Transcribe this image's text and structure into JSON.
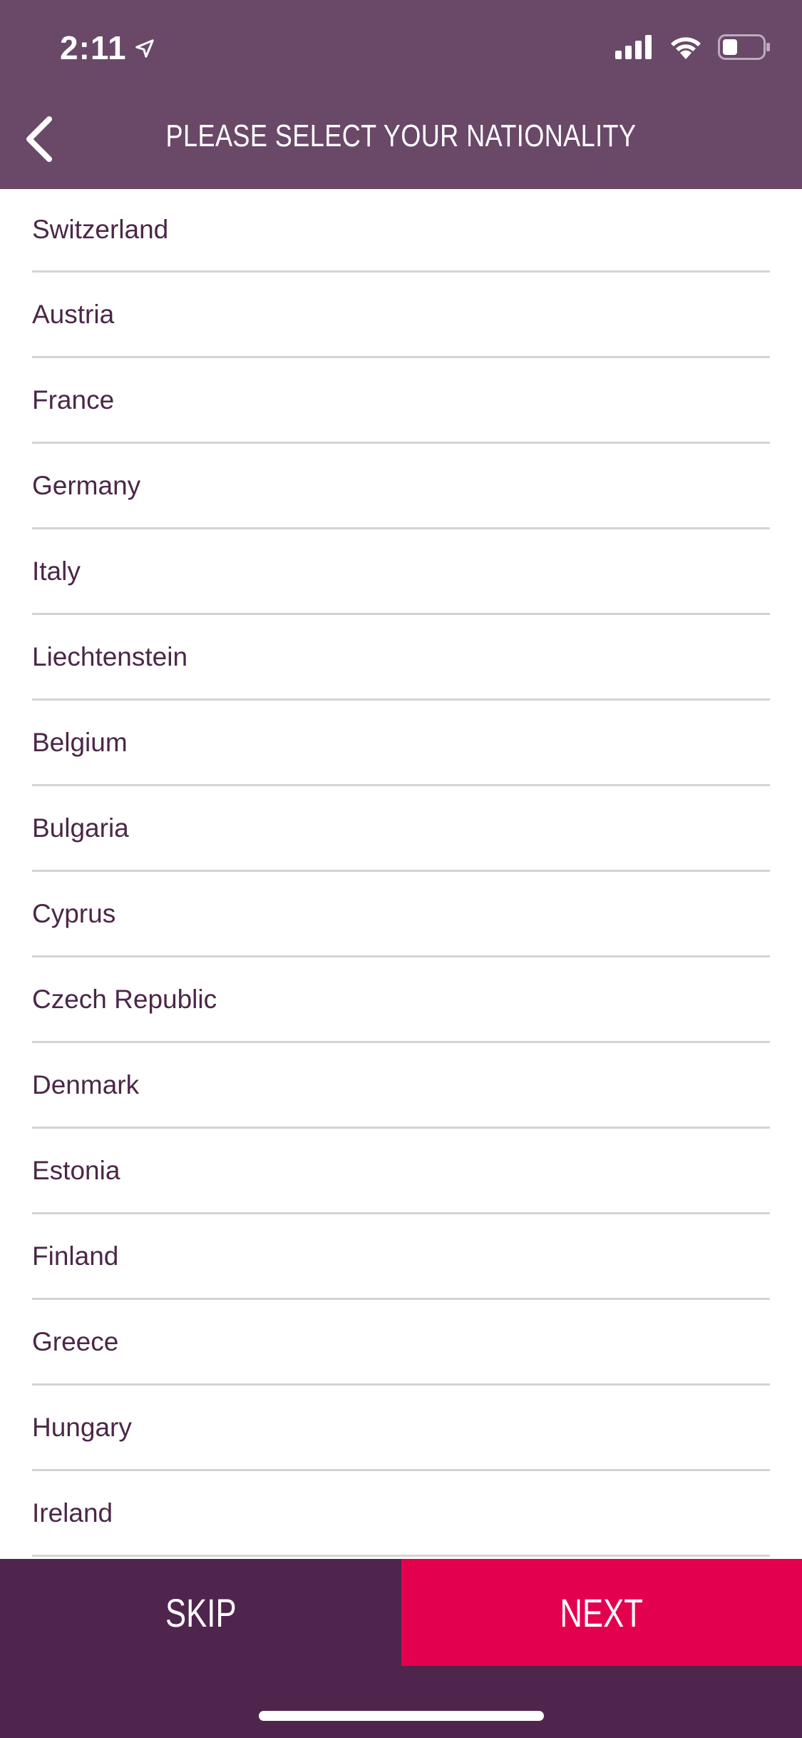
{
  "status_bar": {
    "time": "2:11",
    "icons": [
      "location-arrow-icon",
      "cellular-signal-icon",
      "wifi-icon",
      "battery-icon"
    ]
  },
  "nav": {
    "back_icon": "chevron-left-icon",
    "title": "PLEASE SELECT YOUR NATIONALITY"
  },
  "countries": [
    "Switzerland",
    "Austria",
    "France",
    "Germany",
    "Italy",
    "Liechtenstein",
    "Belgium",
    "Bulgaria",
    "Cyprus",
    "Czech Republic",
    "Denmark",
    "Estonia",
    "Finland",
    "Greece",
    "Hungary",
    "Ireland"
  ],
  "bottom": {
    "skip_label": "SKIP",
    "next_label": "NEXT"
  },
  "colors": {
    "header_bg": "#694868",
    "bottom_bg": "#4f254d",
    "next_bg": "#e3004f",
    "list_text": "#4b2748",
    "divider": "#d4d4d4"
  }
}
